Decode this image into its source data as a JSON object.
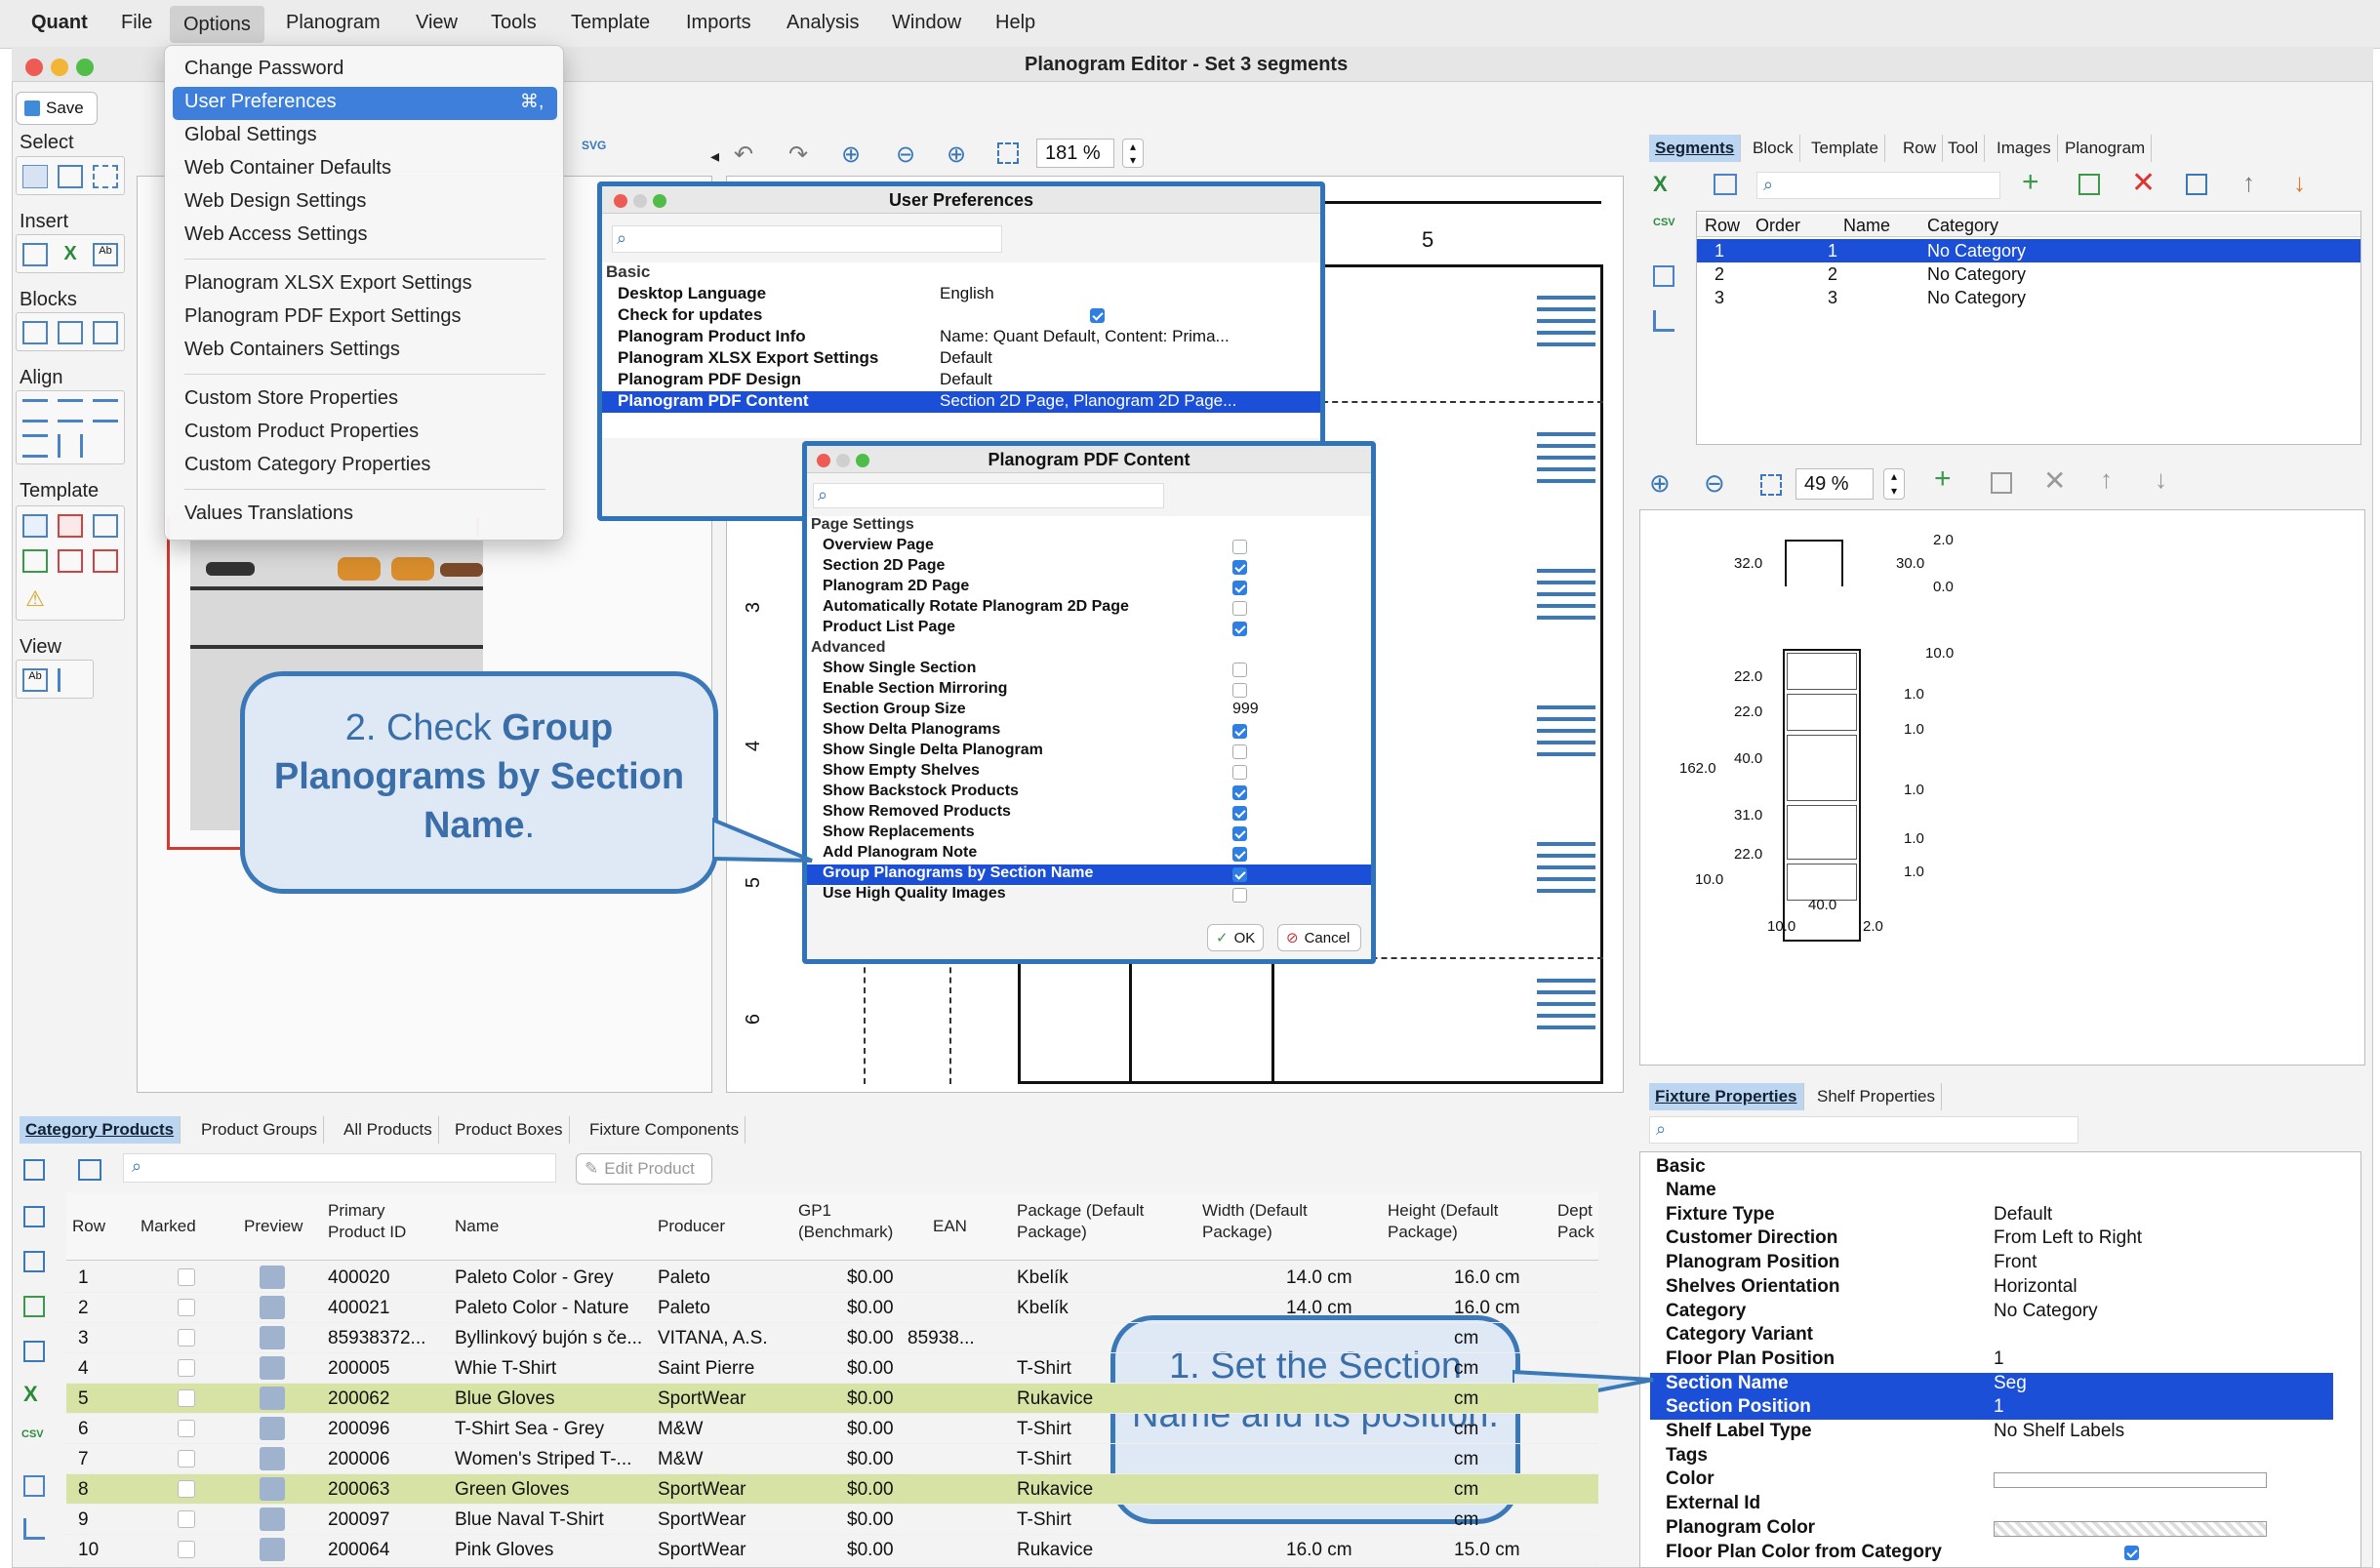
{
  "menubar": {
    "app": "Quant",
    "items": [
      "File",
      "Options",
      "Planogram",
      "View",
      "Tools",
      "Template",
      "Imports",
      "Analysis",
      "Window",
      "Help"
    ],
    "active": "Options"
  },
  "window": {
    "title": "Planogram Editor - Set 3 segments"
  },
  "toolbar": {
    "save_label": "Save",
    "zoom_value": "181 %",
    "svg_label": "SVG",
    "mini_zoom_value": "49 %"
  },
  "sidebar": {
    "select": "Select",
    "insert": "Insert",
    "blocks": "Blocks",
    "align": "Align",
    "template": "Template",
    "view": "View"
  },
  "options_menu": {
    "items": [
      "Change Password",
      "User Preferences",
      "Global Settings",
      "Web Container Defaults",
      "Web Design Settings",
      "Web Access Settings",
      "Planogram XLSX Export Settings",
      "Planogram PDF Export Settings",
      "Web Containers Settings",
      "Custom Store Properties",
      "Custom Product Properties",
      "Custom Category Properties",
      "Values Translations"
    ],
    "highlighted_shortcut": "⌘,"
  },
  "user_prefs": {
    "title": "User Preferences",
    "group": "Basic",
    "rows": [
      {
        "key": "Desktop Language",
        "value": "English"
      },
      {
        "key": "Check for updates",
        "value": ""
      },
      {
        "key": "Planogram Product Info",
        "value": "Name: Quant Default, Content: Prima..."
      },
      {
        "key": "Planogram XLSX Export Settings",
        "value": "Default"
      },
      {
        "key": "Planogram PDF Design",
        "value": "Default"
      },
      {
        "key": "Planogram PDF Content",
        "value": "Section 2D Page, Planogram 2D Page..."
      }
    ]
  },
  "pdf_content": {
    "title": "Planogram PDF Content",
    "groups": {
      "page": "Page Settings",
      "advanced": "Advanced"
    },
    "page_rows": [
      {
        "key": "Overview Page",
        "checked": false
      },
      {
        "key": "Section 2D Page",
        "checked": true
      },
      {
        "key": "Planogram 2D Page",
        "checked": true
      },
      {
        "key": "Automatically Rotate Planogram 2D Page",
        "checked": false
      },
      {
        "key": "Product List Page",
        "checked": true
      }
    ],
    "adv_rows": [
      {
        "key": "Show Single Section",
        "checked": false
      },
      {
        "key": "Enable Section Mirroring",
        "checked": false
      },
      {
        "key": "Section Group Size",
        "value": "999"
      },
      {
        "key": "Show Delta Planograms",
        "checked": true
      },
      {
        "key": "Show Single Delta Planogram",
        "checked": false
      },
      {
        "key": "Show Empty Shelves",
        "checked": false
      },
      {
        "key": "Show Backstock Products",
        "checked": true
      },
      {
        "key": "Show Removed Products",
        "checked": true
      },
      {
        "key": "Show Replacements",
        "checked": true
      },
      {
        "key": "Add Planogram Note",
        "checked": true
      },
      {
        "key": "Group Planograms by Section Name",
        "checked": true
      },
      {
        "key": "Use High Quality Images",
        "checked": false
      }
    ],
    "ok": "OK",
    "cancel": "Cancel"
  },
  "callouts": {
    "step2_a": "2. Check ",
    "step2_b": "Group Planograms by Section Name",
    "step2_c": ".",
    "step1": "1. Set the Section Name and its position."
  },
  "canvas": {
    "top_label": "5",
    "side_labels": [
      "3",
      "4",
      "5",
      "6"
    ]
  },
  "segments": {
    "tabs": [
      "Segments",
      "Block",
      "Template",
      "Row",
      "Tool",
      "Images",
      "Planogram"
    ],
    "columns": [
      "Row",
      "Order",
      "Name",
      "Category"
    ],
    "rows": [
      [
        "1",
        "1",
        "",
        "No Category"
      ],
      [
        "2",
        "2",
        "",
        "No Category"
      ],
      [
        "3",
        "3",
        "",
        "No Category"
      ]
    ]
  },
  "fixture": {
    "tabs": [
      "Fixture Properties",
      "Shelf Properties"
    ],
    "group": "Basic",
    "rows": [
      {
        "k": "Name",
        "v": ""
      },
      {
        "k": "Fixture Type",
        "v": "Default"
      },
      {
        "k": "Customer Direction",
        "v": "From Left to Right"
      },
      {
        "k": "Planogram Position",
        "v": "Front"
      },
      {
        "k": "Shelves Orientation",
        "v": "Horizontal"
      },
      {
        "k": "Category",
        "v": "No Category"
      },
      {
        "k": "Category Variant",
        "v": ""
      },
      {
        "k": "Floor Plan Position",
        "v": "1"
      },
      {
        "k": "Section Name",
        "v": "Seg"
      },
      {
        "k": "Section Position",
        "v": "1"
      },
      {
        "k": "Shelf Label Type",
        "v": "No Shelf Labels"
      },
      {
        "k": "Tags",
        "v": ""
      },
      {
        "k": "Color",
        "v": ""
      },
      {
        "k": "External Id",
        "v": ""
      },
      {
        "k": "Planogram Color",
        "v": ""
      },
      {
        "k": "Floor Plan Color from Category",
        "v": ""
      }
    ]
  },
  "products": {
    "tabs": [
      "Category Products",
      "Product Groups",
      "All Products",
      "Product Boxes",
      "Fixture Components"
    ],
    "edit_label": "Edit Product",
    "columns": [
      "Row",
      "Marked",
      "Preview",
      "Primary Product ID",
      "Name",
      "Producer",
      "GP1 (Benchmark)",
      "EAN",
      "Package (Default Package)",
      "Width (Default Package)",
      "Height (Default Package)",
      "Dept Pack"
    ],
    "rows": [
      [
        "1",
        "400020",
        "Paleto Color - Grey",
        "Paleto",
        "$0.00",
        "",
        "Kbelík",
        "14.0 cm",
        "16.0 cm"
      ],
      [
        "2",
        "400021",
        "Paleto Color - Nature",
        "Paleto",
        "$0.00",
        "",
        "Kbelík",
        "14.0 cm",
        "16.0 cm"
      ],
      [
        "3",
        "85938372...",
        "Byllinkový bujón s če...",
        "VITANA, A.S.",
        "$0.00",
        "85938...",
        "",
        "",
        "cm"
      ],
      [
        "4",
        "200005",
        "Whie T-Shirt",
        "Saint Pierre",
        "$0.00",
        "",
        "T-Shirt",
        "",
        "cm"
      ],
      [
        "5",
        "200062",
        "Blue Gloves",
        "SportWear",
        "$0.00",
        "",
        "Rukavice",
        "",
        "cm"
      ],
      [
        "6",
        "200096",
        "T-Shirt Sea - Grey",
        "M&W",
        "$0.00",
        "",
        "T-Shirt",
        "",
        "cm"
      ],
      [
        "7",
        "200006",
        "Women's Striped T-...",
        "M&W",
        "$0.00",
        "",
        "T-Shirt",
        "",
        "cm"
      ],
      [
        "8",
        "200063",
        "Green Gloves",
        "SportWear",
        "$0.00",
        "",
        "Rukavice",
        "",
        "cm"
      ],
      [
        "9",
        "200097",
        "Blue Naval T-Shirt",
        "SportWear",
        "$0.00",
        "",
        "T-Shirt",
        "",
        "cm"
      ],
      [
        "10",
        "200064",
        "Pink Gloves",
        "SportWear",
        "$0.00",
        "",
        "Rukavice",
        "16.0 cm",
        "15.0 cm"
      ]
    ]
  },
  "mini_dims": [
    "32.0",
    "2.0",
    "30.0",
    "0.0",
    "10.0",
    "22.0",
    "22.0",
    "40.0",
    "162.0",
    "31.0",
    "22.0",
    "10.0",
    "1.0",
    "1.0",
    "1.0",
    "1.0",
    "1.0",
    "40.0",
    "10.0",
    "2.0"
  ]
}
